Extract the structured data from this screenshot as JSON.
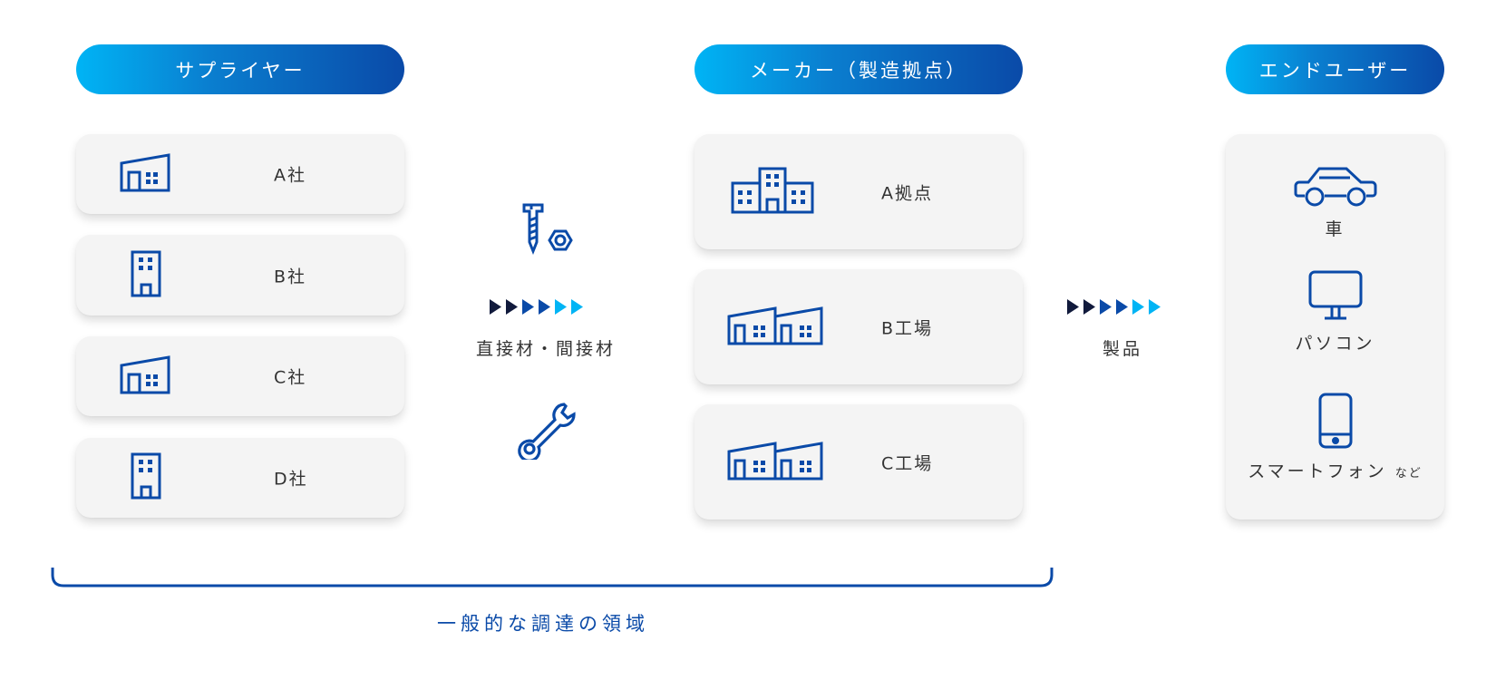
{
  "colors": {
    "primary": "#0a4aa8",
    "gradient_start": "#00b4f5",
    "gradient_end": "#0a4aa8",
    "card_bg": "#f4f4f4",
    "arrow_dark": "#111a3c",
    "arrow_mid": "#0a4aa8",
    "arrow_light": "#00b4f5"
  },
  "columns": {
    "supplier": {
      "header": "サプライヤー",
      "items": [
        {
          "label": "A社",
          "icon": "factory-icon"
        },
        {
          "label": "B社",
          "icon": "office-building-icon"
        },
        {
          "label": "C社",
          "icon": "factory-icon"
        },
        {
          "label": "D社",
          "icon": "office-building-icon"
        }
      ]
    },
    "materials": {
      "label": "直接材・間接材",
      "icons": [
        "screw-nut-icon",
        "wrench-icon"
      ]
    },
    "maker": {
      "header": "メーカー（製造拠点）",
      "items": [
        {
          "label": "A拠点",
          "icon": "headquarters-icon"
        },
        {
          "label": "B工場",
          "icon": "double-factory-icon"
        },
        {
          "label": "C工場",
          "icon": "double-factory-icon"
        }
      ]
    },
    "products": {
      "label": "製品"
    },
    "end_user": {
      "header": "エンドユーザー",
      "items": [
        {
          "label": "車",
          "icon": "car-icon"
        },
        {
          "label": "パソコン",
          "icon": "monitor-icon"
        },
        {
          "label": "スマートフォン",
          "suffix": "など",
          "icon": "smartphone-icon"
        }
      ]
    }
  },
  "bracket": {
    "label": "一般的な調達の領域"
  }
}
